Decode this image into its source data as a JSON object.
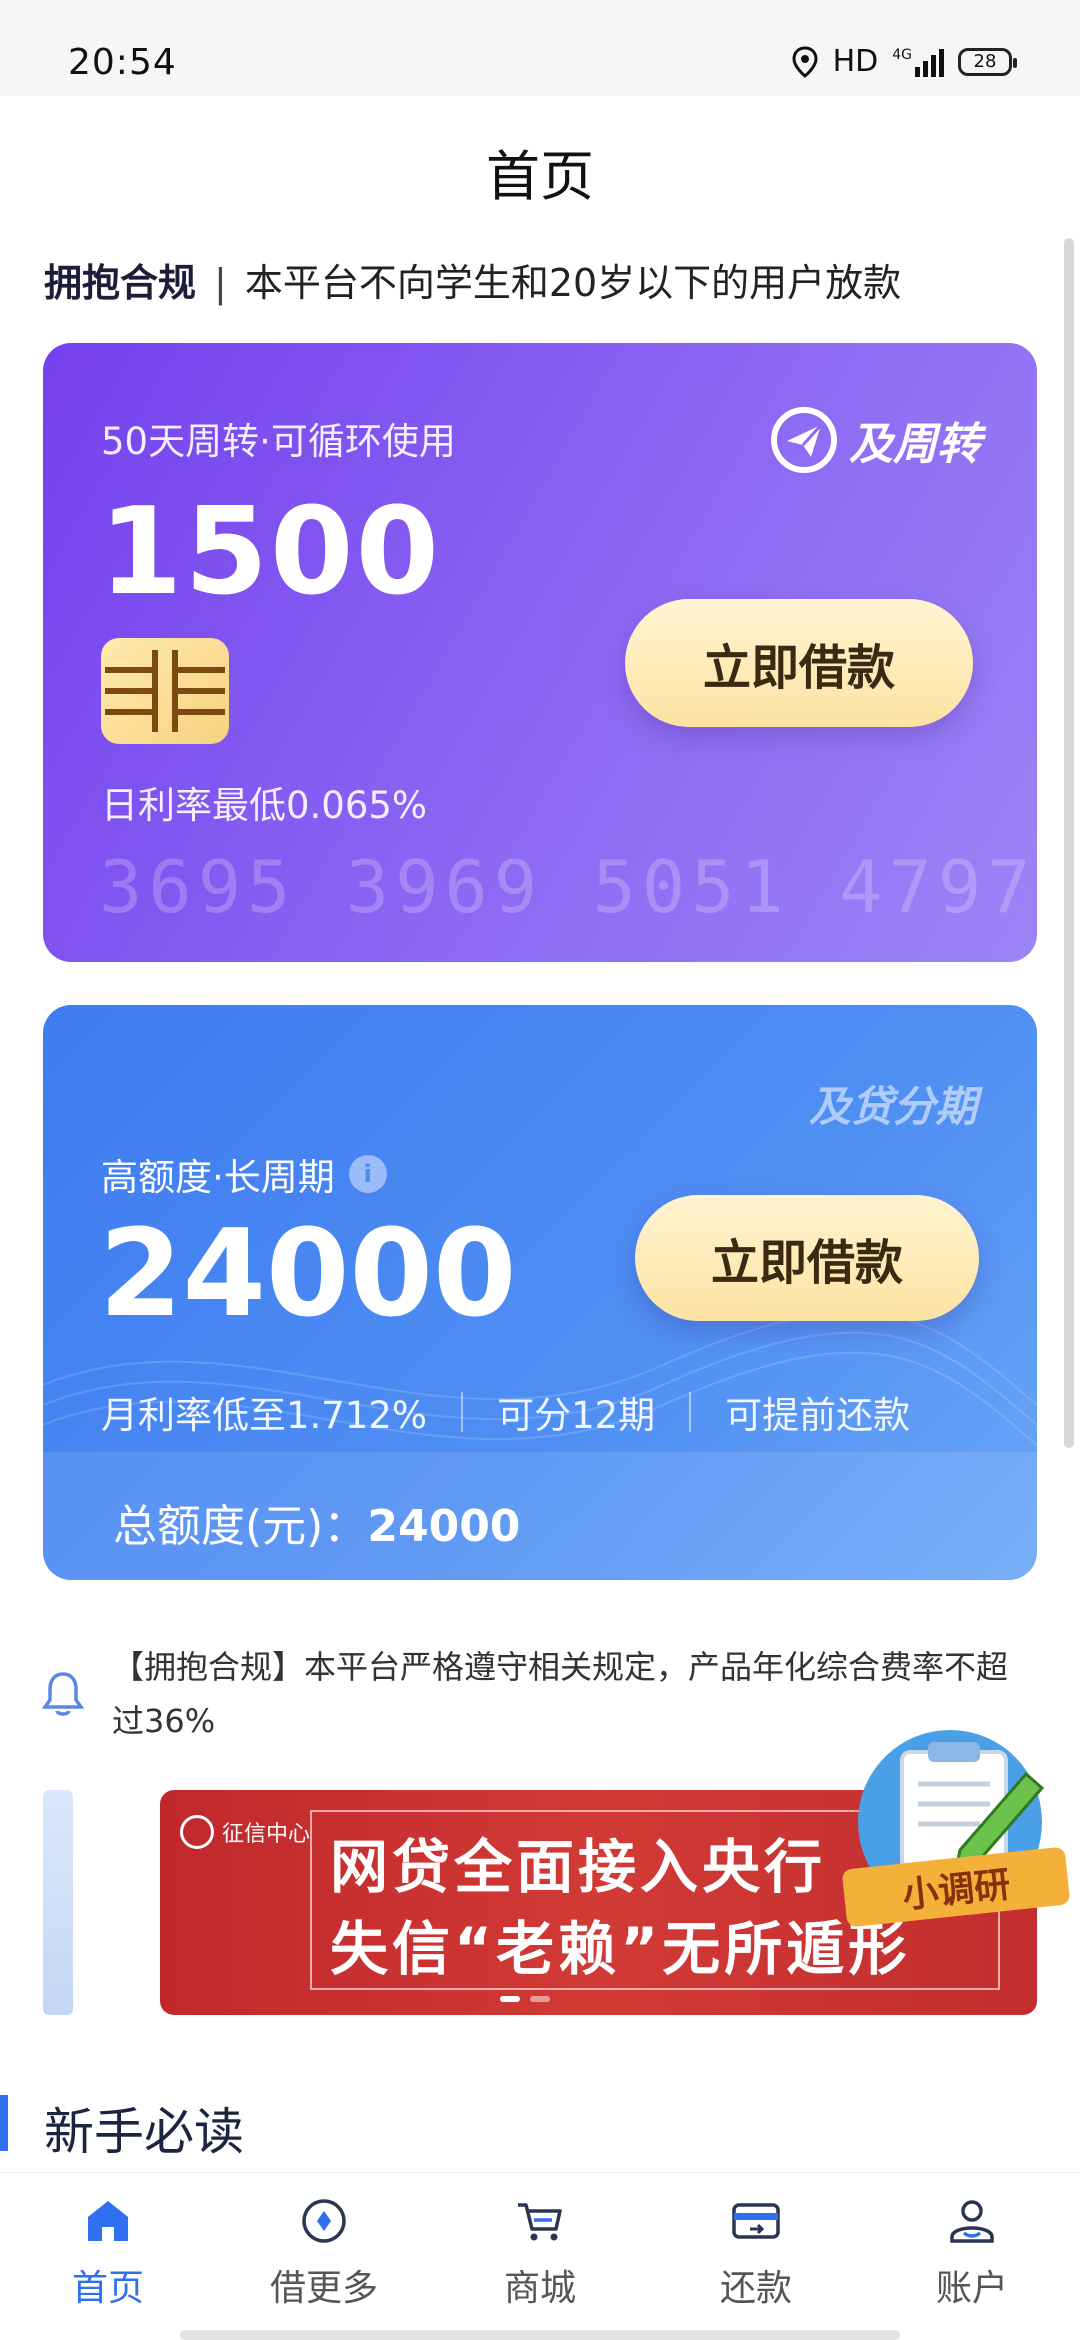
{
  "status": {
    "time": "20:54",
    "network": "HD",
    "signal": "4G",
    "battery": "28"
  },
  "header": {
    "title": "首页"
  },
  "compliance": {
    "tag": "拥抱合规",
    "sep": "|",
    "text": "本平台不向学生和20岁以下的用户放款"
  },
  "card1": {
    "subtitle": "50天周转·可循环使用",
    "amount": "1500",
    "brand": "及周转",
    "button": "立即借款",
    "rate": "日利率最低0.065%",
    "card_number": "3695 3969 5051 4797"
  },
  "card2": {
    "brand": "及贷分期",
    "subtitle": "高额度·长周期",
    "amount": "24000",
    "button": "立即借款",
    "features": [
      "月利率低至1.712%",
      "可分12期",
      "可提前还款"
    ],
    "total_label": "总额度(元)：",
    "total_value": "24000"
  },
  "notice": {
    "text": "【拥抱合规】本平台严格遵守相关规定，产品年化综合费率不超过36%"
  },
  "banner": {
    "seal": "征信中心",
    "line1": "网贷全面接入央行",
    "line2": "失信“老赖”无所遁形",
    "survey_label": "小调研"
  },
  "section": {
    "title": "新手必读"
  },
  "tabs": [
    {
      "label": "首页",
      "icon": "home-icon",
      "active": true
    },
    {
      "label": "借更多",
      "icon": "compass-icon",
      "active": false
    },
    {
      "label": "商城",
      "icon": "cart-icon",
      "active": false
    },
    {
      "label": "还款",
      "icon": "card-icon",
      "active": false
    },
    {
      "label": "账户",
      "icon": "user-icon",
      "active": false
    }
  ],
  "colors": {
    "accent": "#2f6ff0",
    "card1": "#7f55f0",
    "card2": "#4a88f2",
    "gold_button": "#fde7aa",
    "banner_red": "#c8302f"
  }
}
